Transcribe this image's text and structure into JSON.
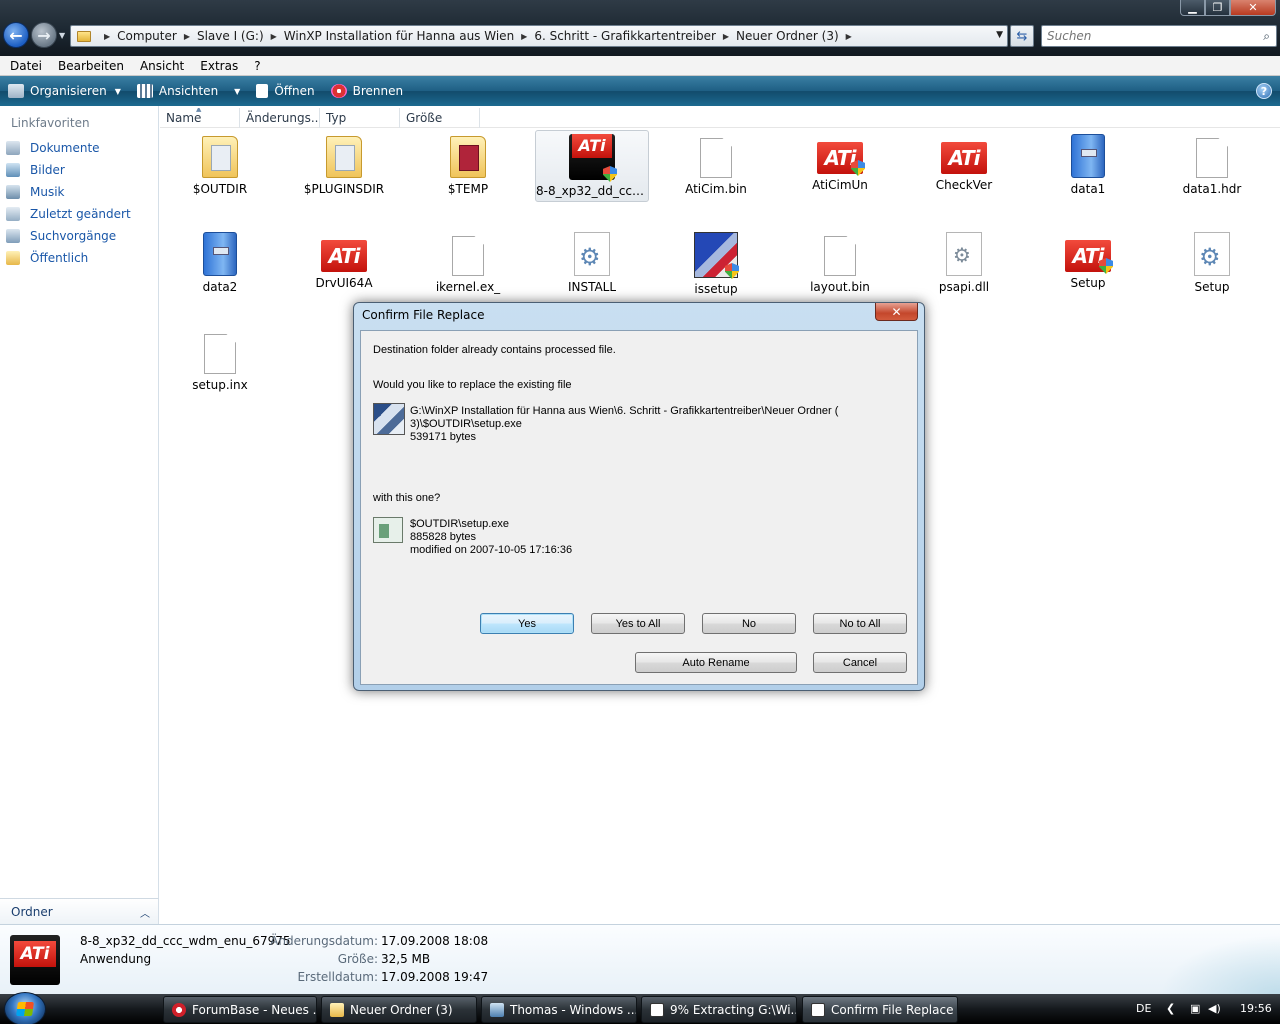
{
  "window": {
    "controls": {
      "minimize": "▁",
      "maximize": "❐",
      "close": "✕"
    }
  },
  "address": {
    "crumbs": [
      "Computer",
      "Slave I (G:)",
      "WinXP Installation für Hanna aus Wien",
      "6. Schritt - Grafikkartentreiber",
      "Neuer Ordner (3)"
    ],
    "search_placeholder": "Suchen"
  },
  "menu": [
    "Datei",
    "Bearbeiten",
    "Ansicht",
    "Extras",
    "?"
  ],
  "toolbar": {
    "organize": "Organisieren",
    "views": "Ansichten",
    "open": "Öffnen",
    "burn": "Brennen"
  },
  "sidebar": {
    "heading": "Linkfavoriten",
    "items": [
      "Dokumente",
      "Bilder",
      "Musik",
      "Zuletzt geändert",
      "Suchvorgänge",
      "Öffentlich"
    ],
    "folders": "Ordner"
  },
  "columns": [
    "Name",
    "Änderungs...",
    "Typ",
    "Größe"
  ],
  "files": [
    {
      "name": "$OUTDIR",
      "icon": "folder"
    },
    {
      "name": "$PLUGINSDIR",
      "icon": "folder"
    },
    {
      "name": "$TEMP",
      "icon": "folder"
    },
    {
      "name": "8-8_xp32_dd_ccc_...",
      "icon": "ati-installer"
    },
    {
      "name": "AtiCim.bin",
      "icon": "document"
    },
    {
      "name": "AtiCimUn",
      "icon": "ati"
    },
    {
      "name": "CheckVer",
      "icon": "ati"
    },
    {
      "name": "data1",
      "icon": "cabinet"
    },
    {
      "name": "data1.hdr",
      "icon": "document"
    },
    {
      "name": "data2",
      "icon": "cabinet"
    },
    {
      "name": "DrvUI64A",
      "icon": "ati"
    },
    {
      "name": "ikernel.ex_",
      "icon": "document"
    },
    {
      "name": "INSTALL",
      "icon": "settings"
    },
    {
      "name": "issetup",
      "icon": "installer"
    },
    {
      "name": "layout.bin",
      "icon": "document"
    },
    {
      "name": "psapi.dll",
      "icon": "dll"
    },
    {
      "name": "Setup",
      "icon": "ati"
    },
    {
      "name": "Setup",
      "icon": "settings"
    },
    {
      "name": "setup.inx",
      "icon": "document"
    }
  ],
  "details": {
    "name": "8-8_xp32_dd_ccc_wdm_enu_67975",
    "type": "Anwendung",
    "modified_label": "Änderungsdatum:",
    "modified": "17.09.2008 18:08",
    "size_label": "Größe:",
    "size": "32,5 MB",
    "created_label": "Erstelldatum:",
    "created": "17.09.2008 19:47"
  },
  "dialog": {
    "title": "Confirm File Replace",
    "line1": "Destination folder already contains processed file.",
    "line2": "Would you like to replace the existing file",
    "existing_path1": "G:\\WinXP Installation für Hanna aus Wien\\6. Schritt - Grafikkartentreiber\\Neuer Ordner (",
    "existing_path2": "3)\\$OUTDIR\\setup.exe",
    "existing_size": "539171 bytes",
    "line3": "with this one?",
    "new_path": "$OUTDIR\\setup.exe",
    "new_size": "885828 bytes",
    "new_modified": "modified on 2007-10-05 17:16:36",
    "buttons": {
      "yes": "Yes",
      "yes_all": "Yes to All",
      "no": "No",
      "no_all": "No to All",
      "rename": "Auto Rename",
      "cancel": "Cancel"
    }
  },
  "taskbar": {
    "tasks": [
      "ForumBase - Neues ...",
      "Neuer Ordner (3)",
      "Thomas - Windows ...",
      "9% Extracting G:\\Wi...",
      "Confirm File Replace"
    ],
    "lang": "DE",
    "time": "19:56"
  }
}
